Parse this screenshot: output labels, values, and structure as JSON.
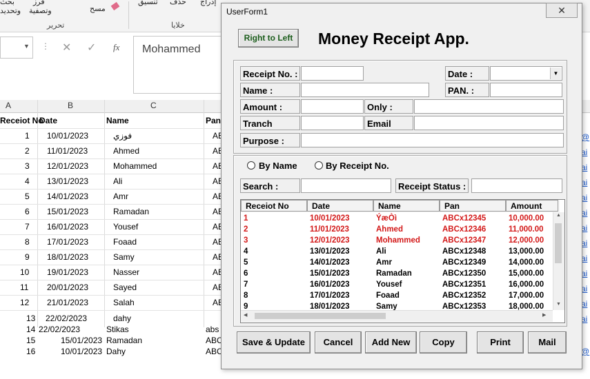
{
  "ribbon": {
    "items": [
      "بحث",
      "فرز",
      "وتحديد",
      "وتصفية",
      "مسح",
      "تنسيق",
      "حذف",
      "إدراج"
    ],
    "groups": [
      "تحرير",
      "خلايا"
    ]
  },
  "formula_bar": {
    "value": "Mohammed",
    "cancel_icon": "✕",
    "enter_icon": "✓",
    "fx": "fx"
  },
  "sheet": {
    "columns": [
      "A",
      "B",
      "C"
    ],
    "headers": [
      "Receiot No",
      "Date",
      "Name",
      "Pan"
    ],
    "rows": [
      {
        "no": "1",
        "date": "10/01/2023",
        "name": "فوزي",
        "pan": "AB"
      },
      {
        "no": "2",
        "date": "11/01/2023",
        "name": "Ahmed",
        "pan": "AB"
      },
      {
        "no": "3",
        "date": "12/01/2023",
        "name": "Mohammed",
        "pan": "AB"
      },
      {
        "no": "4",
        "date": "13/01/2023",
        "name": "Ali",
        "pan": "AB"
      },
      {
        "no": "5",
        "date": "14/01/2023",
        "name": "Amr",
        "pan": "AB"
      },
      {
        "no": "6",
        "date": "15/01/2023",
        "name": "Ramadan",
        "pan": "AB"
      },
      {
        "no": "7",
        "date": "16/01/2023",
        "name": "Yousef",
        "pan": "AB"
      },
      {
        "no": "8",
        "date": "17/01/2023",
        "name": "Foaad",
        "pan": "AB"
      },
      {
        "no": "9",
        "date": "18/01/2023",
        "name": "Samy",
        "pan": "AB"
      },
      {
        "no": "10",
        "date": "19/01/2023",
        "name": "Nasser",
        "pan": "AB"
      },
      {
        "no": "11",
        "date": "20/01/2023",
        "name": "Sayed",
        "pan": "AB"
      },
      {
        "no": "12",
        "date": "21/01/2023",
        "name": "Salah",
        "pan": "AB"
      }
    ],
    "extra_rows": [
      {
        "no": "13",
        "date": "22/02/2023",
        "name": "dahy",
        "pan": ""
      },
      {
        "no": "14",
        "date": "22/02/2023",
        "name": "Stikas",
        "pan": "abs"
      },
      {
        "no": "15",
        "date": "15/01/2023",
        "name": "Ramadan",
        "pan": "ABC"
      },
      {
        "no": "16",
        "date": "10/01/2023",
        "name": "Dahy",
        "pan": "ABC"
      }
    ],
    "link_fragments": [
      "@",
      "ai",
      "ai",
      "ai",
      "ai",
      "ai",
      "ai",
      "ai",
      "ai",
      "ai",
      "ai",
      "ai",
      "ai",
      "@"
    ]
  },
  "userform": {
    "title": "UserForm1",
    "close_icon": "✕",
    "rtl_button": "Right to Left",
    "heading": "Money Receipt App.",
    "labels": {
      "receipt_no": "Receipt No. :",
      "date": "Date :",
      "name": "Name :",
      "pan": "PAN. :",
      "amount": "Amount :",
      "only": "Only :",
      "tranch": "Tranch",
      "email": "Email",
      "purpose": "Purpose :",
      "search": "Search :",
      "receipt_status": "Receipt Status :"
    },
    "radios": {
      "by_name": "By Name",
      "by_receipt": "By Receipt No."
    },
    "list_headers": [
      "Receiot No",
      "Date",
      "Name",
      "Pan",
      "Amount"
    ],
    "list_rows": [
      {
        "no": "1",
        "date": "10/01/2023",
        "name": "ÝæÒì",
        "pan": "ABCx12345",
        "amount": "10,000.00",
        "red": true
      },
      {
        "no": "2",
        "date": "11/01/2023",
        "name": "Ahmed",
        "pan": "ABCx12346",
        "amount": "11,000.00",
        "red": true
      },
      {
        "no": "3",
        "date": "12/01/2023",
        "name": "Mohammed",
        "pan": "ABCx12347",
        "amount": "12,000.00",
        "red": true
      },
      {
        "no": "4",
        "date": "13/01/2023",
        "name": "Ali",
        "pan": "ABCx12348",
        "amount": "13,000.00",
        "red": false
      },
      {
        "no": "5",
        "date": "14/01/2023",
        "name": "Amr",
        "pan": "ABCx12349",
        "amount": "14,000.00",
        "red": false
      },
      {
        "no": "6",
        "date": "15/01/2023",
        "name": "Ramadan",
        "pan": "ABCx12350",
        "amount": "15,000.00",
        "red": false
      },
      {
        "no": "7",
        "date": "16/01/2023",
        "name": "Yousef",
        "pan": "ABCx12351",
        "amount": "16,000.00",
        "red": false
      },
      {
        "no": "8",
        "date": "17/01/2023",
        "name": "Foaad",
        "pan": "ABCx12352",
        "amount": "17,000.00",
        "red": false
      },
      {
        "no": "9",
        "date": "18/01/2023",
        "name": "Samy",
        "pan": "ABCx12353",
        "amount": "18,000.00",
        "red": false
      }
    ],
    "buttons": [
      "Save & Update",
      "Cancel",
      "Add New",
      "Copy",
      "Print",
      "Mail"
    ],
    "colors": {
      "red_rows": "#d31818",
      "heading": "#000000",
      "rtl_text": "#1a5c1a"
    }
  }
}
